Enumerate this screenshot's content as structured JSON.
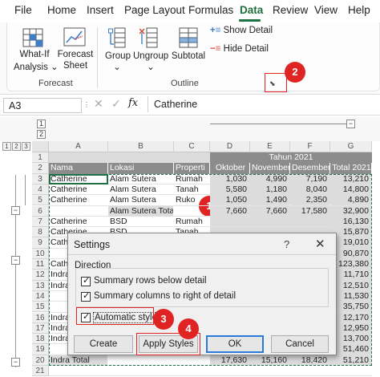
{
  "menu": {
    "items": [
      "File",
      "Home",
      "Insert",
      "Page Layout",
      "Formulas",
      "Data",
      "Review",
      "View",
      "Help"
    ],
    "active": "Data"
  },
  "ribbon": {
    "whatif_line1": "What-If",
    "whatif_line2": "Analysis",
    "forecast_line1": "Forecast",
    "forecast_line2": "Sheet",
    "forecast_group": "Forecast",
    "group_label": "Group",
    "ungroup_label": "Ungroup",
    "subtotal_label": "Subtotal",
    "show_detail": "Show Detail",
    "hide_detail": "Hide Detail",
    "outline_group": "Outline"
  },
  "formula_bar": {
    "name_box": "A3",
    "fx": "fx",
    "value": "Catherine"
  },
  "sheet": {
    "levels": [
      "1",
      "2",
      "3"
    ],
    "columns": [
      "A",
      "B",
      "C",
      "D",
      "E",
      "F",
      "G"
    ],
    "rows": [
      "1",
      "2",
      "3",
      "4",
      "5",
      "6",
      "7",
      "8",
      "9",
      "10",
      "11",
      "12",
      "13",
      "14",
      "15",
      "16",
      "17",
      "18",
      "19",
      "20",
      "21"
    ],
    "title": "Tahun 2021",
    "headers": [
      "Nama",
      "Lokasi",
      "Properti",
      "Oktober",
      "November",
      "Desember",
      "Total 2021"
    ],
    "data": [
      [
        "Catherine",
        "Alam Sutera",
        "Rumah",
        "1,030",
        "4,990",
        "7,190",
        "13,210"
      ],
      [
        "Catherine",
        "Alam Sutera",
        "Tanah",
        "5,580",
        "1,180",
        "8,040",
        "14,800"
      ],
      [
        "Catherine",
        "Alam Sutera",
        "Ruko",
        "1,050",
        "1,490",
        "2,350",
        "4,890"
      ],
      [
        "",
        "Alam Sutera Total",
        "",
        "7,660",
        "7,660",
        "17,580",
        "32,900"
      ],
      [
        "Catherine",
        "BSD",
        "Rumah",
        "",
        "",
        "",
        "16,130"
      ],
      [
        "Catherine",
        "BSD",
        "Tanah",
        "",
        "",
        "",
        "15,870"
      ],
      [
        "Cathe",
        "",
        "",
        "",
        "",
        "",
        "19,010"
      ],
      [
        "",
        "",
        "",
        "",
        "",
        "",
        "90,870"
      ],
      [
        "Cathe",
        "",
        "",
        "",
        "",
        "",
        "123,380"
      ],
      [
        "Indra",
        "",
        "",
        "",
        "",
        "",
        "11,710"
      ],
      [
        "Indra",
        "",
        "",
        "",
        "",
        "",
        "12,510"
      ],
      [
        "",
        "",
        "",
        "",
        "",
        "",
        "11,530"
      ],
      [
        "",
        "",
        "",
        "",
        "",
        "",
        "35,750"
      ],
      [
        "Indra",
        "",
        "",
        "",
        "",
        "",
        "12,170"
      ],
      [
        "Indra",
        "",
        "",
        "",
        "",
        "",
        "12,950"
      ],
      [
        "Indra",
        "",
        "",
        "",
        "",
        "",
        "13,700"
      ],
      [
        "",
        "",
        "",
        "",
        "",
        "",
        "51,460"
      ],
      [
        "Indra Total",
        "",
        "",
        "17,630",
        "15,160",
        "18,420",
        "51,210"
      ]
    ]
  },
  "dialog": {
    "title": "Settings",
    "help": "?",
    "close": "✕",
    "legend": "Direction",
    "opt1": "Summary rows below detail",
    "opt2": "Summary columns to right of detail",
    "opt3": "Automatic styles",
    "btn_create": "Create",
    "btn_apply": "Apply Styles",
    "btn_ok": "OK",
    "btn_cancel": "Cancel"
  },
  "callouts": [
    "1",
    "2",
    "3",
    "4"
  ],
  "colors": {
    "accent_green": "#1e7145",
    "callout_red": "#e02424",
    "header_grey": "#8c8c8c",
    "ok_border": "#2a7ad8"
  }
}
